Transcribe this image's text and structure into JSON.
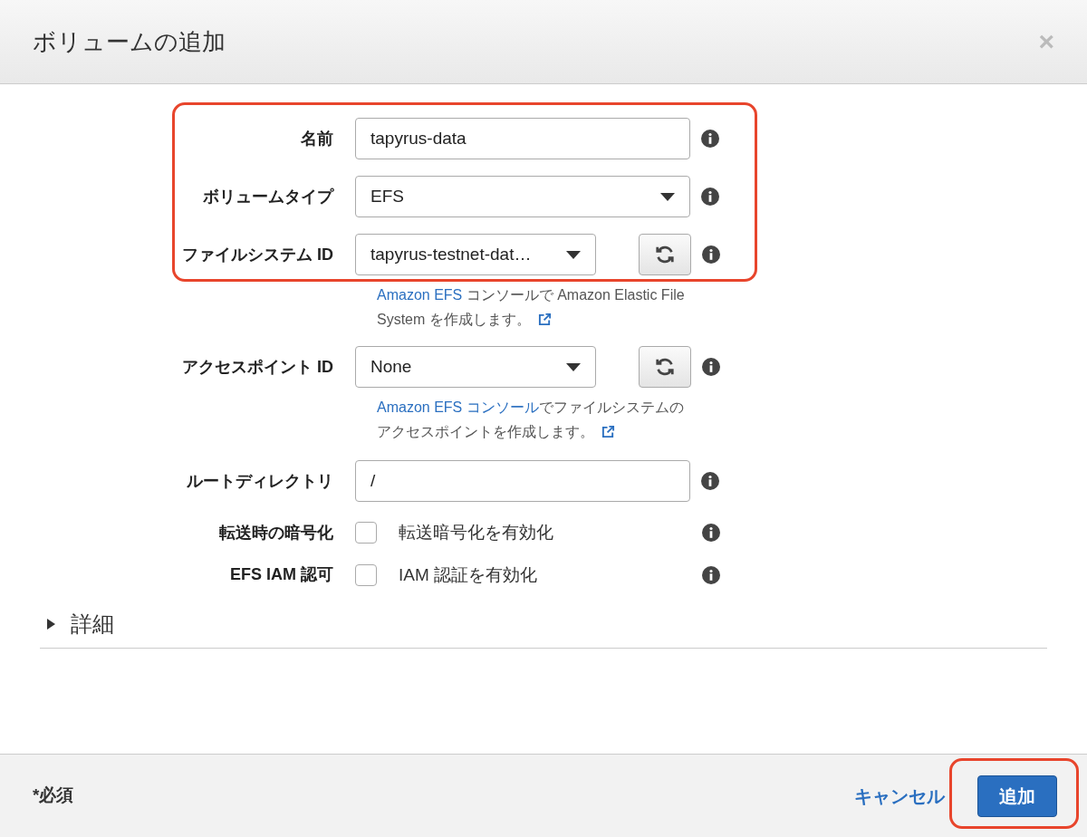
{
  "dialog": {
    "title": "ボリュームの追加",
    "close": "×"
  },
  "fields": [
    {
      "kind": "text",
      "label": "名前",
      "value": "tapyrus-data"
    },
    {
      "kind": "select",
      "label": "ボリュームタイプ",
      "value": "EFS"
    },
    {
      "kind": "select_refresh",
      "label": "ファイルシステム ID",
      "value": "tapyrus-testnet-dat…",
      "help": [
        {
          "text": "Amazon EFS",
          "link": true
        },
        {
          "text": " コンソールで Amazon Elastic File System を作成します。",
          "link": false
        }
      ]
    },
    {
      "kind": "select_refresh",
      "label": "アクセスポイント ID",
      "value": "None",
      "help": [
        {
          "text": "Amazon EFS コンソール",
          "link": true
        },
        {
          "text": "でファイルシステムのアクセスポイントを作成します。",
          "link": false
        }
      ]
    },
    {
      "kind": "text",
      "label": "ルートディレクトリ",
      "value": "/"
    },
    {
      "kind": "checkbox",
      "label": "転送時の暗号化",
      "option": "転送暗号化を有効化",
      "checked": false
    },
    {
      "kind": "checkbox",
      "label": "EFS IAM 認可",
      "option": "IAM 認証を有効化",
      "checked": false
    }
  ],
  "details": {
    "label": "詳細",
    "expanded": false
  },
  "footer": {
    "required": "*必須",
    "cancel": "キャンセル",
    "submit": "追加"
  }
}
